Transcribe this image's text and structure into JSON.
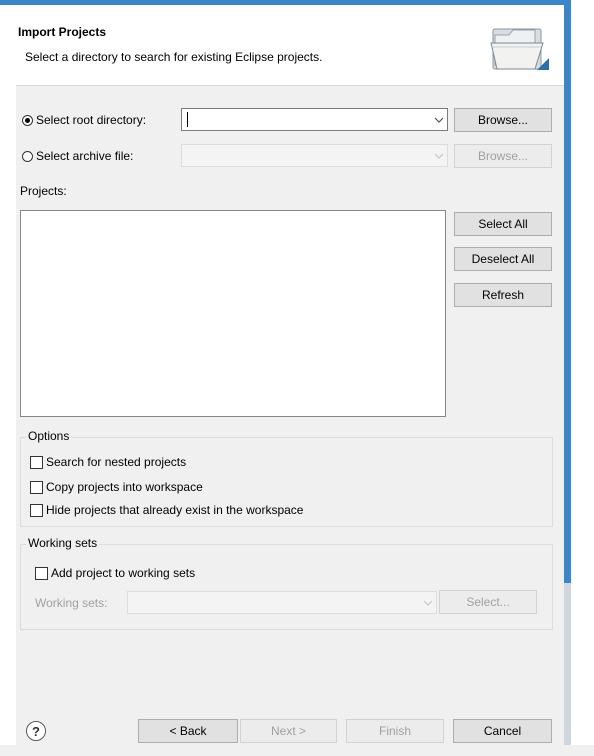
{
  "dialog": {
    "title": "Import Projects",
    "description": "Select a directory to search for existing Eclipse projects."
  },
  "source": {
    "root_directory_label": "Select root directory:",
    "root_directory_value": "",
    "root_browse_label": "Browse...",
    "archive_file_label": "Select archive file:",
    "archive_file_value": "",
    "archive_browse_label": "Browse..."
  },
  "projects": {
    "label": "Projects:",
    "items": [],
    "select_all_label": "Select All",
    "deselect_all_label": "Deselect All",
    "refresh_label": "Refresh"
  },
  "options": {
    "group_label": "Options",
    "nested_label": "Search for nested projects",
    "copy_label": "Copy projects into workspace",
    "hide_label": "Hide projects that already exist in the workspace"
  },
  "working_sets": {
    "group_label": "Working sets",
    "add_label": "Add project to working sets",
    "field_label": "Working sets:",
    "select_label": "Select..."
  },
  "footer": {
    "help_glyph": "?",
    "back_label": "< Back",
    "next_label": "Next >",
    "finish_label": "Finish",
    "cancel_label": "Cancel"
  },
  "colors": {
    "accent": "#3a86c8",
    "panel": "#f0f0f0",
    "button": "#e1e1e1"
  }
}
